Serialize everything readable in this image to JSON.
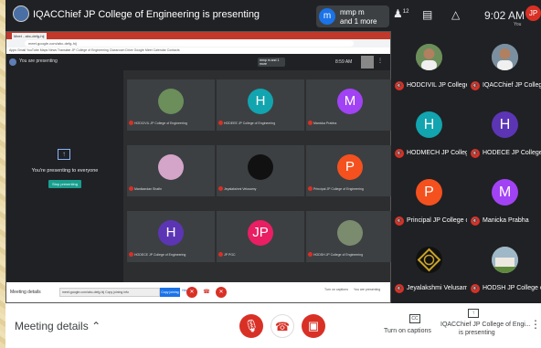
{
  "topbar": {
    "presenting_title": "IQACChief JP College of Engineering is presenting",
    "pill_avatar": "m",
    "pill_line1": "mmp m",
    "pill_line2": "and 1 more",
    "people_count": "12",
    "time": "9:02 AM",
    "you_initials": "JP",
    "you_label": "You"
  },
  "shared_screen": {
    "tab_label": "Meet - abc-defg-hij",
    "address": "meet.google.com/abc-defg-hij",
    "bookmarks": "Apps  Gmail  YouTube  Maps  News  Translate  JP College of Engineering  Classroom  Drive  Google Meet  Calendar  Contacts",
    "title": "You are presenting",
    "pill_text": "mmp m and 1 more",
    "time": "8:59 AM",
    "panel_text": "You're presenting to everyone",
    "panel_button": "Stop presenting",
    "tiles": [
      {
        "name": "HODCIVIL JP College of Engineering",
        "initial": "",
        "color": "#6b8e5a"
      },
      {
        "name": "HODEEE JP College of Engineering",
        "initial": "H",
        "color": "#12a4af"
      },
      {
        "name": "Manicka Prabha",
        "initial": "M",
        "color": "#a142f4"
      },
      {
        "name": "Manikandan Shafin",
        "initial": "",
        "color": "#d4a5c8"
      },
      {
        "name": "Jeyalakshmi Velusamy",
        "initial": "",
        "color": "#111111"
      },
      {
        "name": "Principal JP College of Engineering",
        "initial": "P",
        "color": "#f4511e"
      },
      {
        "name": "HODECE JP College of Engineering",
        "initial": "H",
        "color": "#5c35b5"
      },
      {
        "name": "JP PGC",
        "initial": "JP",
        "color": "#e91e63"
      },
      {
        "name": "HODSH JP College of Engineering",
        "initial": "",
        "color": "#7a8b6e"
      }
    ],
    "bottom_meeting": "Meeting details",
    "bottom_url": "meet.google.com/abc-defg-hij  Copy joining info",
    "bottom_url_btn": "Copy joining",
    "bottom_hide": "Hide",
    "bottom_captions": "Turn on captions",
    "bottom_present": "You are presenting"
  },
  "participants": [
    {
      "name": "HODCIVIL JP College ...",
      "initial": "",
      "color": "#6b8e5a",
      "kind": "photo-man"
    },
    {
      "name": "IQACChief JP College ...",
      "initial": "",
      "color": "#7a8fa0",
      "kind": "photo-man2"
    },
    {
      "name": "HODMECH JP College ...",
      "initial": "H",
      "color": "#12a4af",
      "kind": "letter"
    },
    {
      "name": "HODECE JP College of ...",
      "initial": "H",
      "color": "#5c35b5",
      "kind": "letter"
    },
    {
      "name": "Principal JP College of...",
      "initial": "P",
      "color": "#f4511e",
      "kind": "letter"
    },
    {
      "name": "Manicka Prabha",
      "initial": "M",
      "color": "#a142f4",
      "kind": "letter"
    },
    {
      "name": "Jeyalakshmi Velusamy",
      "initial": "",
      "color": "#111111",
      "kind": "logo"
    },
    {
      "name": "HODSH JP College of ...",
      "initial": "",
      "color": "#7a8b6e",
      "kind": "photo-building"
    }
  ],
  "bottombar": {
    "meeting_details": "Meeting details",
    "captions_label": "Turn on captions",
    "presenter_line1": "IQACChief JP College of Engi...",
    "presenter_line2": "is presenting"
  },
  "colors": {
    "end_call": "#d93025",
    "accent": "#1a73e8"
  }
}
